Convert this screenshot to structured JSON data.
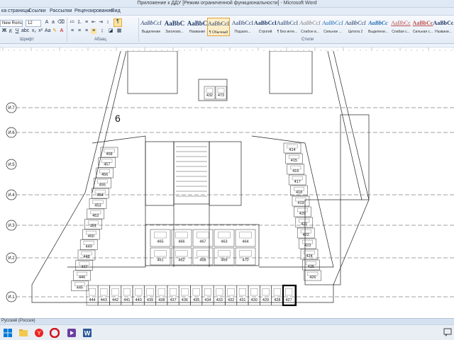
{
  "window": {
    "title": "Приложение к ДДУ [Режим ограниченной функциональности] - Microsoft Word"
  },
  "tabs": [
    {
      "label": "ка страницы"
    },
    {
      "label": "Ссылки"
    },
    {
      "label": "Рассылки"
    },
    {
      "label": "Рецензирование"
    },
    {
      "label": "Вид"
    }
  ],
  "ribbon": {
    "font_name": "New Roman",
    "font_size": "12",
    "groups": {
      "font": "Шрифт",
      "paragraph": "Абзац",
      "styles": "Стили"
    },
    "styles": [
      {
        "sample": "AaBbCcI",
        "name": "Выделение"
      },
      {
        "sample": "AaBbC",
        "name": "Заголово..."
      },
      {
        "sample": "AaBbC",
        "name": "Название"
      },
      {
        "sample": "AaBbCcI",
        "name": "¶ Обычный",
        "active": true
      },
      {
        "sample": "AaBbCcI",
        "name": "Подзаго..."
      },
      {
        "sample": "AaBbCcI",
        "name": "Строгий"
      },
      {
        "sample": "AaBbCcI",
        "name": "¶ Без инте..."
      },
      {
        "sample": "AaBbCcI",
        "name": "Слабое в..."
      },
      {
        "sample": "AaBbCcI",
        "name": "Сильное ..."
      },
      {
        "sample": "AaBbCcI",
        "name": "Цитата 2"
      },
      {
        "sample": "AaBbCc",
        "name": "Выделени..."
      },
      {
        "sample": "AaBbCc",
        "name": "Слабая с..."
      },
      {
        "sample": "AaBbCc",
        "name": "Сильная с..."
      },
      {
        "sample": "AaBbCc",
        "name": "Названи..."
      }
    ]
  },
  "plan": {
    "floor_label": "6",
    "axis_labels": [
      "И.7",
      "И.6",
      "И.5",
      "И.4",
      "И.3",
      "И.2",
      "И.1"
    ],
    "bottom_numbers": [
      "444",
      "443",
      "442",
      "441",
      "440",
      "439",
      "438",
      "437",
      "436",
      "435",
      "434",
      "433",
      "432",
      "431",
      "430",
      "429",
      "428",
      "427"
    ],
    "left_numbers": [
      "458",
      "457",
      "456",
      "455",
      "454",
      "453",
      "452",
      "451",
      "450",
      "449",
      "448",
      "447",
      "446",
      "445"
    ],
    "center_numbers": [
      "465",
      "466",
      "467",
      "463",
      "464",
      "461",
      "462",
      "468",
      "469",
      "470"
    ],
    "right_numbers": [
      "414",
      "415",
      "416",
      "417",
      "418",
      "419",
      "420",
      "421",
      "422",
      "423",
      "424",
      "425",
      "426"
    ],
    "top_numbers": [
      "432",
      "473"
    ]
  },
  "statusbar": {
    "language": "Русский (Россия)"
  }
}
